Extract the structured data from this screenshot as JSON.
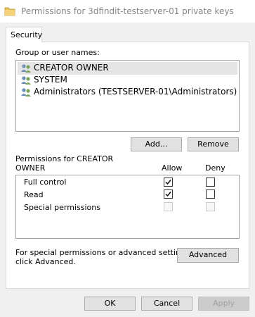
{
  "window": {
    "title": "Permissions for 3dfindit-testserver-01 private keys"
  },
  "tabs": [
    {
      "label": "Security"
    }
  ],
  "group_section": {
    "label": "Group or user names:",
    "items": [
      {
        "label": "CREATOR OWNER",
        "selected": true
      },
      {
        "label": "SYSTEM",
        "selected": false
      },
      {
        "label": "Administrators (TESTSERVER-01\\Administrators)",
        "selected": false
      }
    ],
    "add_label": "Add...",
    "remove_label": "Remove"
  },
  "permissions": {
    "label_line1": "Permissions for CREATOR",
    "label_line2": "OWNER",
    "allow_header": "Allow",
    "deny_header": "Deny",
    "rows": [
      {
        "label": "Full control",
        "allow": true,
        "deny": false,
        "enabled": true
      },
      {
        "label": "Read",
        "allow": true,
        "deny": false,
        "enabled": true
      },
      {
        "label": "Special permissions",
        "allow": false,
        "deny": false,
        "enabled": false
      }
    ]
  },
  "advanced": {
    "text_line1": "For special permissions or advanced settings,",
    "text_line2": "click Advanced.",
    "button_label": "Advanced"
  },
  "footer": {
    "ok_label": "OK",
    "cancel_label": "Cancel",
    "apply_label": "Apply"
  }
}
